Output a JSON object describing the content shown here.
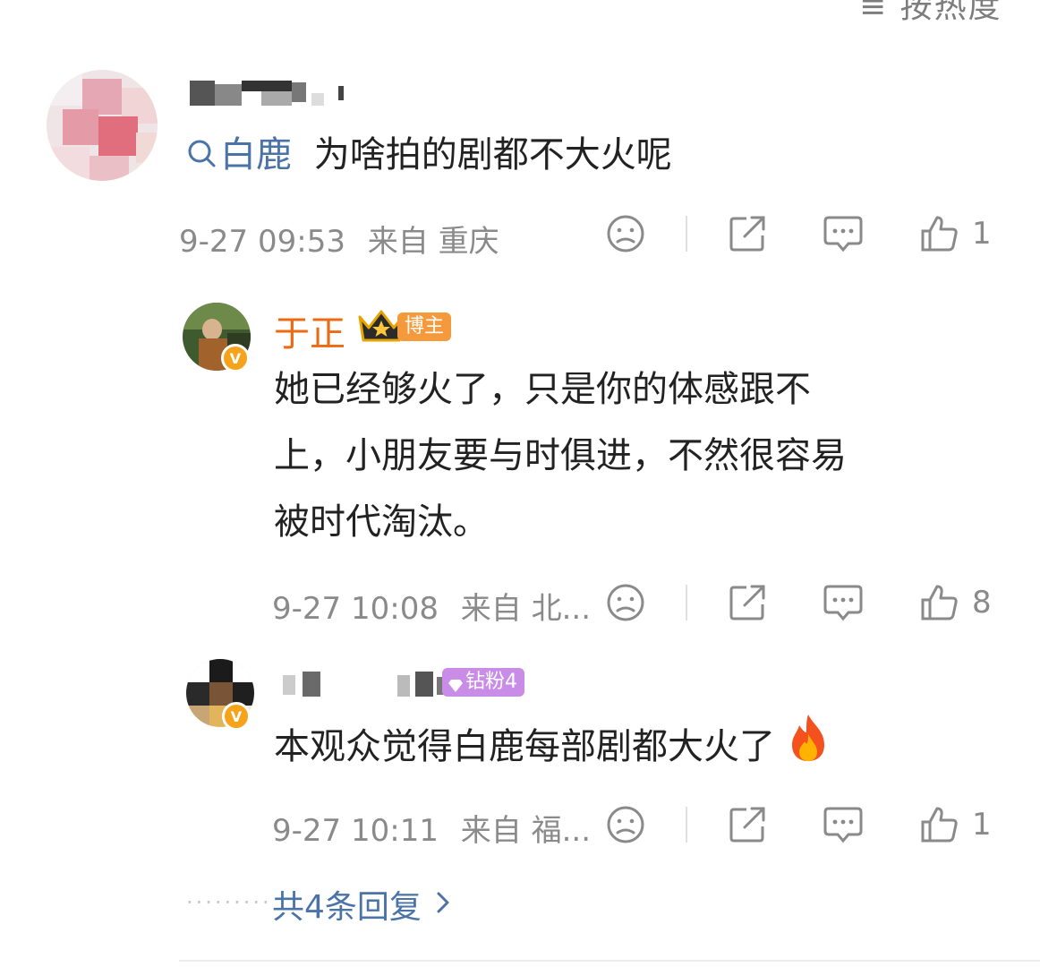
{
  "top_label": "≡ 按热度",
  "comments": [
    {
      "topic": "白鹿",
      "text": "为啥拍的剧都不大火呢",
      "time": "9-27 09:53",
      "location": "来自 重庆",
      "like_count": "1"
    },
    {
      "username": "于正",
      "badge": "博主",
      "text_lines": [
        "她已经够火了，只是你的体感跟不",
        "上，小朋友要与时俱进，不然很容易",
        "被时代淘汰。"
      ],
      "time": "9-27 10:08",
      "location": "来自 北...",
      "like_count": "8"
    },
    {
      "badge": "钻粉4",
      "text": "本观众觉得白鹿每部剧都大火了",
      "time": "9-27 10:11",
      "location": "来自 福...",
      "like_count": "1"
    }
  ],
  "more_replies": "共4条回复",
  "icons": {
    "dislike": "sad-face-icon",
    "share": "share-icon",
    "comment": "comment-icon",
    "like": "thumbs-up-icon",
    "vip": "v-verified-icon",
    "crown": "crown-icon",
    "fire": "fire-icon"
  },
  "colors": {
    "link": "#4a73a8",
    "name_highlight": "#ec6a12",
    "meta": "#8a8a8a",
    "badge_bozhu": "#f59a3c",
    "badge_fan": "#c98de8"
  }
}
